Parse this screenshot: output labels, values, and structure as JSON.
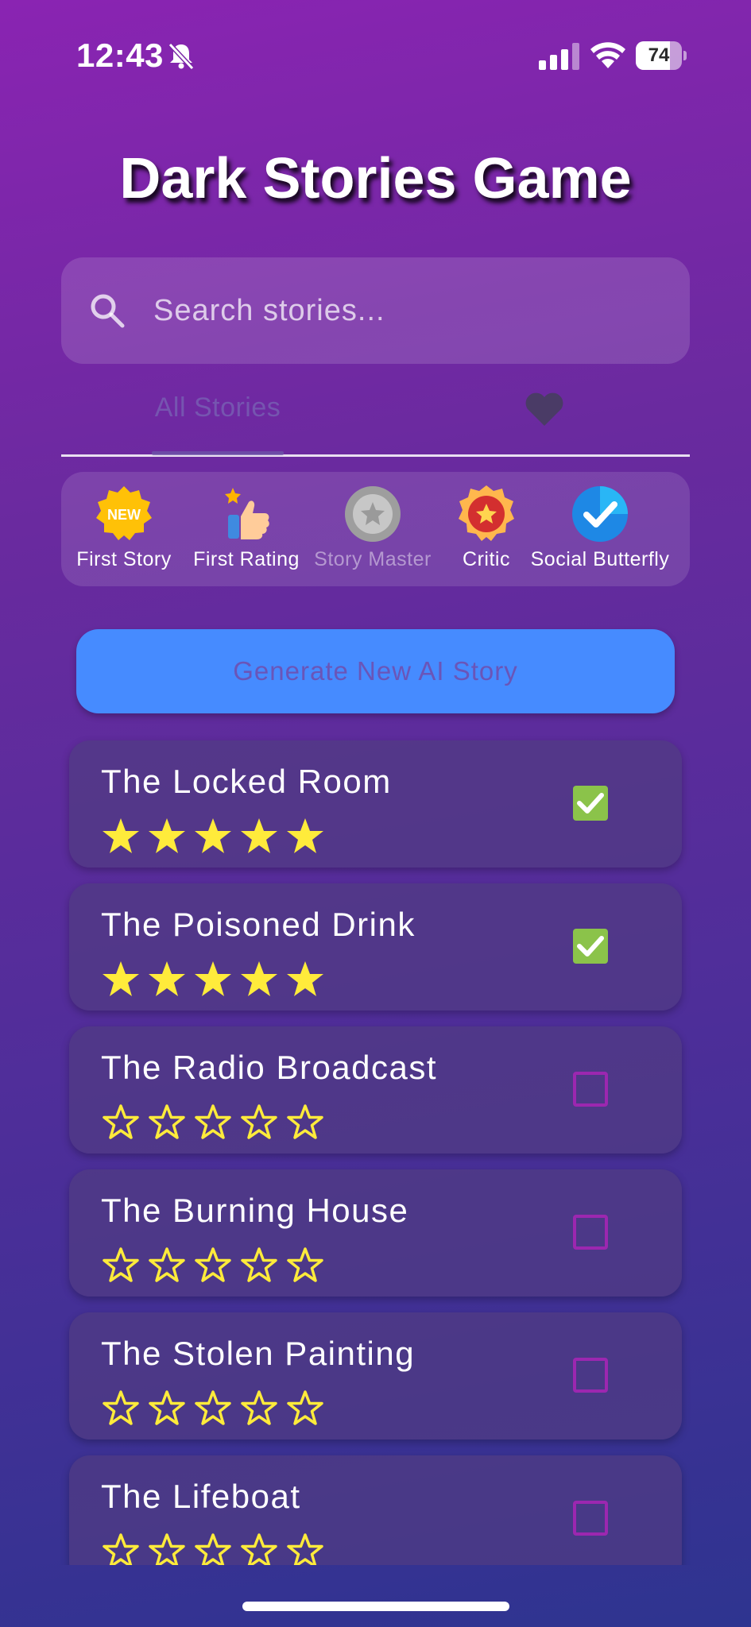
{
  "status": {
    "time": "12:43",
    "battery": "74",
    "battery_level_percent": 74
  },
  "app": {
    "title": "Dark Stories Game"
  },
  "search": {
    "placeholder": "Search stories..."
  },
  "tabs": {
    "all_label": "All Stories",
    "favorites_icon": "heart-icon"
  },
  "achievements": [
    {
      "label": "First Story",
      "icon": "new-badge-icon",
      "unlocked": true
    },
    {
      "label": "First Rating",
      "icon": "thumbs-up-icon",
      "unlocked": true
    },
    {
      "label": "Story Master",
      "icon": "medal-icon",
      "unlocked": false
    },
    {
      "label": "Critic",
      "icon": "star-medal-icon",
      "unlocked": true
    },
    {
      "label": "Social Butterfly",
      "icon": "check-badge-icon",
      "unlocked": true
    }
  ],
  "generate_button": {
    "label": "Generate New AI Story"
  },
  "stories": [
    {
      "title": "The Locked Room",
      "rating": 5,
      "completed": true
    },
    {
      "title": "The Poisoned Drink",
      "rating": 5,
      "completed": true
    },
    {
      "title": "The Radio Broadcast",
      "rating": 0,
      "completed": false
    },
    {
      "title": "The Burning House",
      "rating": 0,
      "completed": false
    },
    {
      "title": "The Stolen Painting",
      "rating": 0,
      "completed": false
    },
    {
      "title": "The Lifeboat",
      "rating": 0,
      "completed": false
    }
  ],
  "colors": {
    "accent_button": "#468bff",
    "star": "#ffeb3b",
    "checkbox_checked": "#8bc34a",
    "checkbox_unchecked": "#9c27b0"
  }
}
